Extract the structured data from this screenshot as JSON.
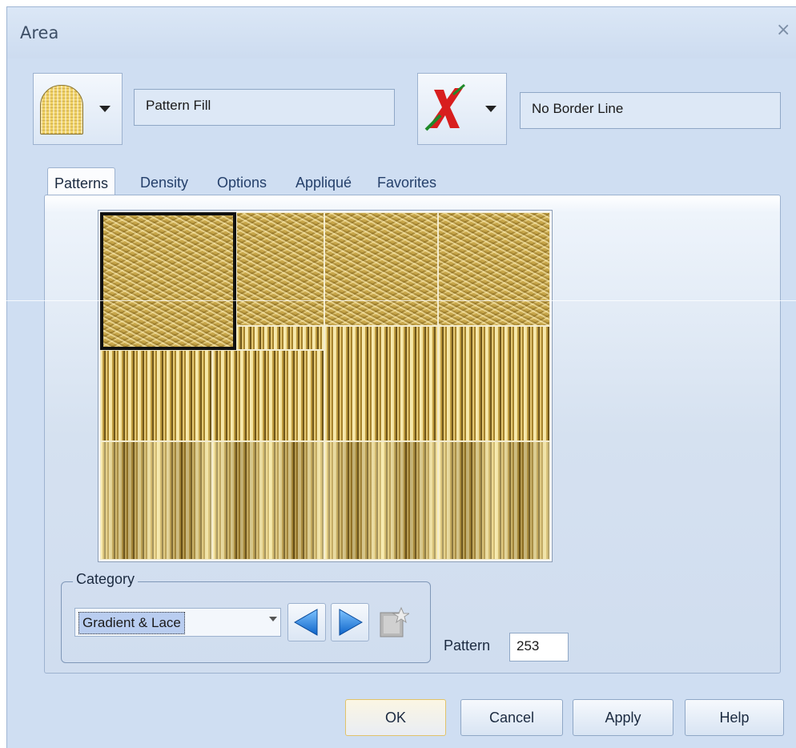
{
  "window": {
    "title": "Area",
    "close_label": "×"
  },
  "fill": {
    "type_value": "Pattern Fill",
    "icon": "pattern-fill-icon"
  },
  "border": {
    "type_value": "No Border Line",
    "icon": "no-border-x-icon"
  },
  "tabs": [
    {
      "label": "Patterns",
      "active": true
    },
    {
      "label": "Density",
      "active": false
    },
    {
      "label": "Options",
      "active": false
    },
    {
      "label": "Appliqué",
      "active": false
    },
    {
      "label": "Favorites",
      "active": false
    }
  ],
  "category": {
    "legend": "Category",
    "selected": "Gradient & Lace"
  },
  "pattern": {
    "label": "Pattern",
    "value": "253"
  },
  "buttons": {
    "ok": "OK",
    "cancel": "Cancel",
    "apply": "Apply",
    "help": "Help"
  },
  "colors": {
    "accent": "#cfdef2",
    "swatch_gold": "#c9a647",
    "no_border_red": "#d81e1e"
  }
}
